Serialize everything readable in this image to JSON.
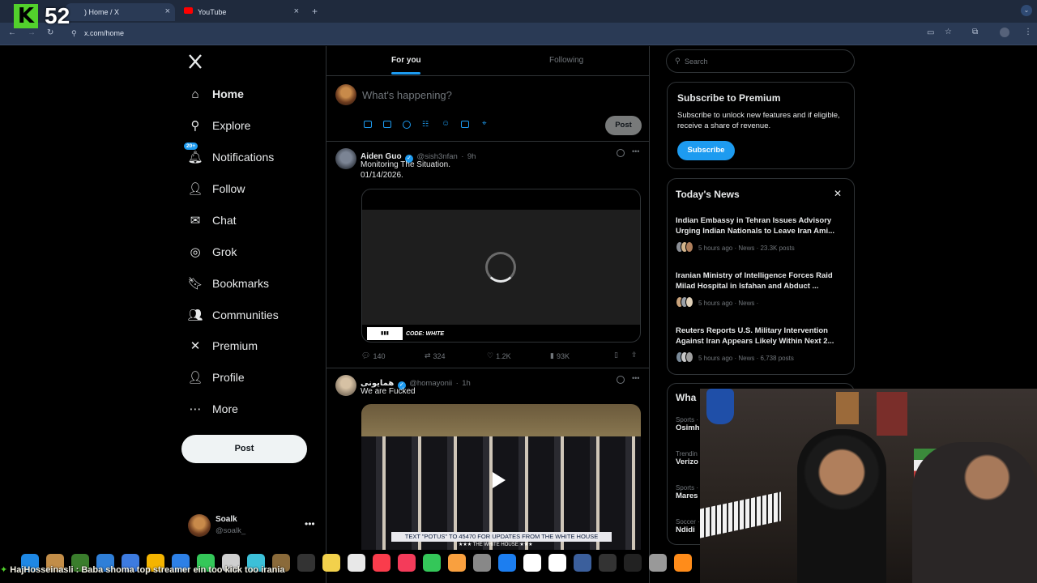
{
  "overlay": {
    "kick_count": "52"
  },
  "browser": {
    "tabs": [
      {
        "label": ") Home / X",
        "active": true
      },
      {
        "label": "YouTube",
        "active": false
      }
    ],
    "url": "x.com/home"
  },
  "nav": {
    "items": [
      {
        "label": "Home",
        "icon": "home-icon",
        "bold": true
      },
      {
        "label": "Explore",
        "icon": "search-icon"
      },
      {
        "label": "Notifications",
        "icon": "bell-icon",
        "badge": "20+"
      },
      {
        "label": "Follow",
        "icon": "add-person-icon"
      },
      {
        "label": "Chat",
        "icon": "mail-icon"
      },
      {
        "label": "Grok",
        "icon": "grok-icon"
      },
      {
        "label": "Bookmarks",
        "icon": "bookmark-icon"
      },
      {
        "label": "Communities",
        "icon": "communities-icon"
      },
      {
        "label": "Premium",
        "icon": "x-logo-icon"
      },
      {
        "label": "Profile",
        "icon": "person-icon"
      },
      {
        "label": "More",
        "icon": "more-circle-icon"
      }
    ],
    "post_label": "Post",
    "user": {
      "name": "Soalk",
      "handle": "@soalk_"
    }
  },
  "feed": {
    "tabs": [
      "For you",
      "Following"
    ],
    "composer": {
      "placeholder": "What's happening?",
      "post_label": "Post"
    },
    "tweets": [
      {
        "name": "Aiden Guo",
        "handle": "@sish3nfan",
        "time": "9h",
        "text": [
          "Monitoring The Situation.",
          "01/14/2026."
        ],
        "media_caption": "CODE: WHITE",
        "stats": {
          "replies": "140",
          "reposts": "324",
          "likes": "1.2K",
          "views": "93K"
        }
      },
      {
        "name": "همایونی",
        "handle": "@homayonii",
        "time": "1h",
        "text": [
          "We are Fucked"
        ],
        "media_caption": "TEXT \"POTUS\" TO 45470 FOR UPDATES FROM THE WHITE HOUSE",
        "media_sub": "★★★ THE WHITE HOUSE ★★★"
      }
    ]
  },
  "sidebar": {
    "search_placeholder": "Search",
    "premium": {
      "title": "Subscribe to Premium",
      "body": "Subscribe to unlock new features and if eligible, receive a share of revenue.",
      "button": "Subscribe"
    },
    "news": {
      "title": "Today's News",
      "items": [
        {
          "title": "Indian Embassy in Tehran Issues Advisory Urging Indian Nationals to Leave Iran Ami...",
          "meta": "5 hours ago · News · 23.3K posts"
        },
        {
          "title": "Iranian Ministry of Intelligence Forces Raid Milad Hospital in Isfahan and Abduct ...",
          "meta": "5 hours ago · News ·"
        },
        {
          "title": "Reuters Reports U.S. Military Intervention Against Iran Appears Likely Within Next 2...",
          "meta": "5 hours ago · News · 6,738 posts"
        }
      ]
    },
    "trends": {
      "title": "Wha",
      "items": [
        {
          "cat": "Sports ·",
          "name": "Osimh"
        },
        {
          "cat": "Trendin",
          "name": "Verizo"
        },
        {
          "cat": "Sports ·",
          "name": "Mares"
        },
        {
          "cat": "Soccer ·",
          "name": "Ndidi"
        }
      ]
    }
  },
  "chat": {
    "text": "HajHosseinasli : Baba shoma top streamer ein too kick too irania"
  },
  "colors": {
    "accent": "#1d9bf0",
    "kick": "#52d12c",
    "verified": "#1d9bf0"
  }
}
